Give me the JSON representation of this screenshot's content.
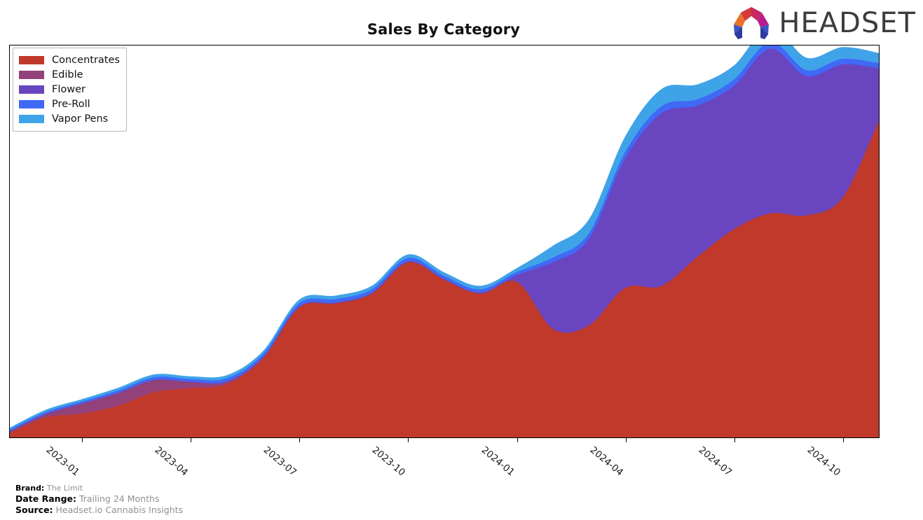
{
  "header": {
    "title": "Sales By Category",
    "logo_text": "HEADSET",
    "logo_colors": {
      "orange": "#E8722A",
      "red": "#D33A3A",
      "crimson": "#C9285F",
      "magenta": "#B61C8C",
      "blue": "#3A55C6",
      "navy": "#2B2F86"
    }
  },
  "legend": {
    "position": "top-left",
    "items": [
      {
        "label": "Concentrates",
        "color": "#C0392B"
      },
      {
        "label": "Edible",
        "color": "#92417A"
      },
      {
        "label": "Flower",
        "color": "#6A45C0"
      },
      {
        "label": "Pre-Roll",
        "color": "#4069F5"
      },
      {
        "label": "Vapor Pens",
        "color": "#3FA3E8"
      }
    ]
  },
  "axis": {
    "x_ticks": [
      "2023-01",
      "2023-04",
      "2023-07",
      "2023-10",
      "2024-01",
      "2024-04",
      "2024-07",
      "2024-10"
    ],
    "y_visible_labels": []
  },
  "footer": {
    "brand_key": "Brand:",
    "brand_value": "The Limit",
    "date_key": "Date Range:",
    "date_value": "Trailing 24 Months",
    "source_key": "Source:",
    "source_value": "Headset.io Cannabis Insights"
  },
  "chart_data": {
    "type": "area",
    "stacked": true,
    "smoothing": "spline",
    "title": "Sales By Category",
    "xlabel": "",
    "ylabel": "",
    "grid": false,
    "legend_position": "top-left",
    "x": [
      "2022-11",
      "2022-12",
      "2023-01",
      "2023-02",
      "2023-03",
      "2023-04",
      "2023-05",
      "2023-06",
      "2023-07",
      "2023-08",
      "2023-09",
      "2023-10",
      "2023-11",
      "2023-12",
      "2024-01",
      "2024-02",
      "2024-03",
      "2024-04",
      "2024-05",
      "2024-06",
      "2024-07",
      "2024-08",
      "2024-09",
      "2024-10",
      "2024-11"
    ],
    "xlim": [
      "2022-11",
      "2024-11"
    ],
    "ylim": [
      0,
      100
    ],
    "series": [
      {
        "name": "Concentrates",
        "color": "#C0392B",
        "values": [
          1.0,
          5.0,
          6.0,
          8.0,
          11.5,
          12.5,
          13.5,
          20.0,
          33.0,
          34.0,
          36.5,
          44.5,
          40.0,
          36.5,
          39.5,
          27.5,
          28.5,
          38.0,
          38.5,
          46.0,
          53.0,
          57.0,
          56.5,
          61.0,
          80.5
        ]
      },
      {
        "name": "Edible",
        "color": "#92417A",
        "values": [
          0.4,
          0.8,
          2.5,
          3.2,
          3.0,
          1.5,
          0.6,
          0.3,
          0.2,
          0.2,
          0.2,
          0.2,
          0.2,
          0.2,
          0.2,
          0.1,
          0.1,
          0.1,
          0.1,
          0.1,
          0.1,
          0.1,
          0.1,
          0.1,
          0.1
        ]
      },
      {
        "name": "Flower",
        "color": "#6A45C0",
        "values": [
          0.1,
          0.1,
          0.1,
          0.1,
          0.1,
          0.1,
          0.1,
          0.1,
          0.1,
          0.1,
          0.1,
          0.1,
          0.1,
          0.2,
          1.6,
          17.0,
          22.0,
          33.0,
          44.0,
          38.5,
          36.5,
          42.0,
          35.5,
          34.0,
          13.5
        ]
      },
      {
        "name": "Pre-Roll",
        "color": "#4069F5",
        "values": [
          0.4,
          0.5,
          0.5,
          0.6,
          0.7,
          0.7,
          0.8,
          0.8,
          0.9,
          0.9,
          0.9,
          0.9,
          0.8,
          0.8,
          0.8,
          1.2,
          1.4,
          1.6,
          1.8,
          1.6,
          1.6,
          1.7,
          1.5,
          1.4,
          1.3
        ]
      },
      {
        "name": "Vapor Pens",
        "color": "#3FA3E8",
        "values": [
          0.5,
          0.6,
          0.6,
          0.7,
          0.7,
          0.7,
          0.8,
          0.8,
          0.9,
          0.9,
          0.9,
          0.9,
          0.9,
          0.9,
          1.0,
          3.0,
          3.6,
          4.0,
          4.4,
          3.8,
          3.6,
          4.0,
          3.2,
          3.0,
          2.6
        ]
      }
    ]
  }
}
